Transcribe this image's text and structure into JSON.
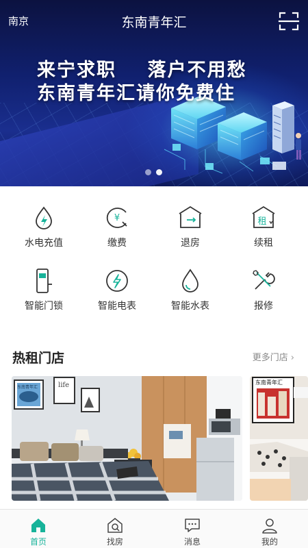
{
  "header": {
    "city": "南京",
    "title": "东南青年汇",
    "scan_icon": "scan-icon"
  },
  "banner": {
    "line1": "来宁求职    落户不用愁",
    "line2": "东南青年汇请你免费住",
    "page_count": 2,
    "active_page": 2
  },
  "services": [
    {
      "label": "水电充值",
      "icon": "water-electric-icon"
    },
    {
      "label": "缴费",
      "icon": "yuan-pay-icon"
    },
    {
      "label": "退房",
      "icon": "checkout-icon"
    },
    {
      "label": "续租",
      "icon": "renew-lease-icon"
    },
    {
      "label": "智能门锁",
      "icon": "smart-lock-icon"
    },
    {
      "label": "智能电表",
      "icon": "electric-meter-icon"
    },
    {
      "label": "智能水表",
      "icon": "water-meter-icon"
    },
    {
      "label": "报修",
      "icon": "repair-icon"
    }
  ],
  "service_icon_text": {
    "pay": "¥",
    "renew": "租"
  },
  "hot_stores": {
    "title": "热租门店",
    "more_label": "更多门店",
    "poster_text": "东南青年汇",
    "frame_text": "life"
  },
  "bottom_nav": [
    {
      "label": "首页",
      "icon": "home-icon",
      "active": true
    },
    {
      "label": "找房",
      "icon": "find-house-icon",
      "active": false
    },
    {
      "label": "消息",
      "icon": "message-icon",
      "active": false
    },
    {
      "label": "我的",
      "icon": "profile-icon",
      "active": false
    }
  ],
  "colors": {
    "accent": "#17b39a",
    "banner_dark": "#0c1240",
    "icon_line": "#333333"
  }
}
